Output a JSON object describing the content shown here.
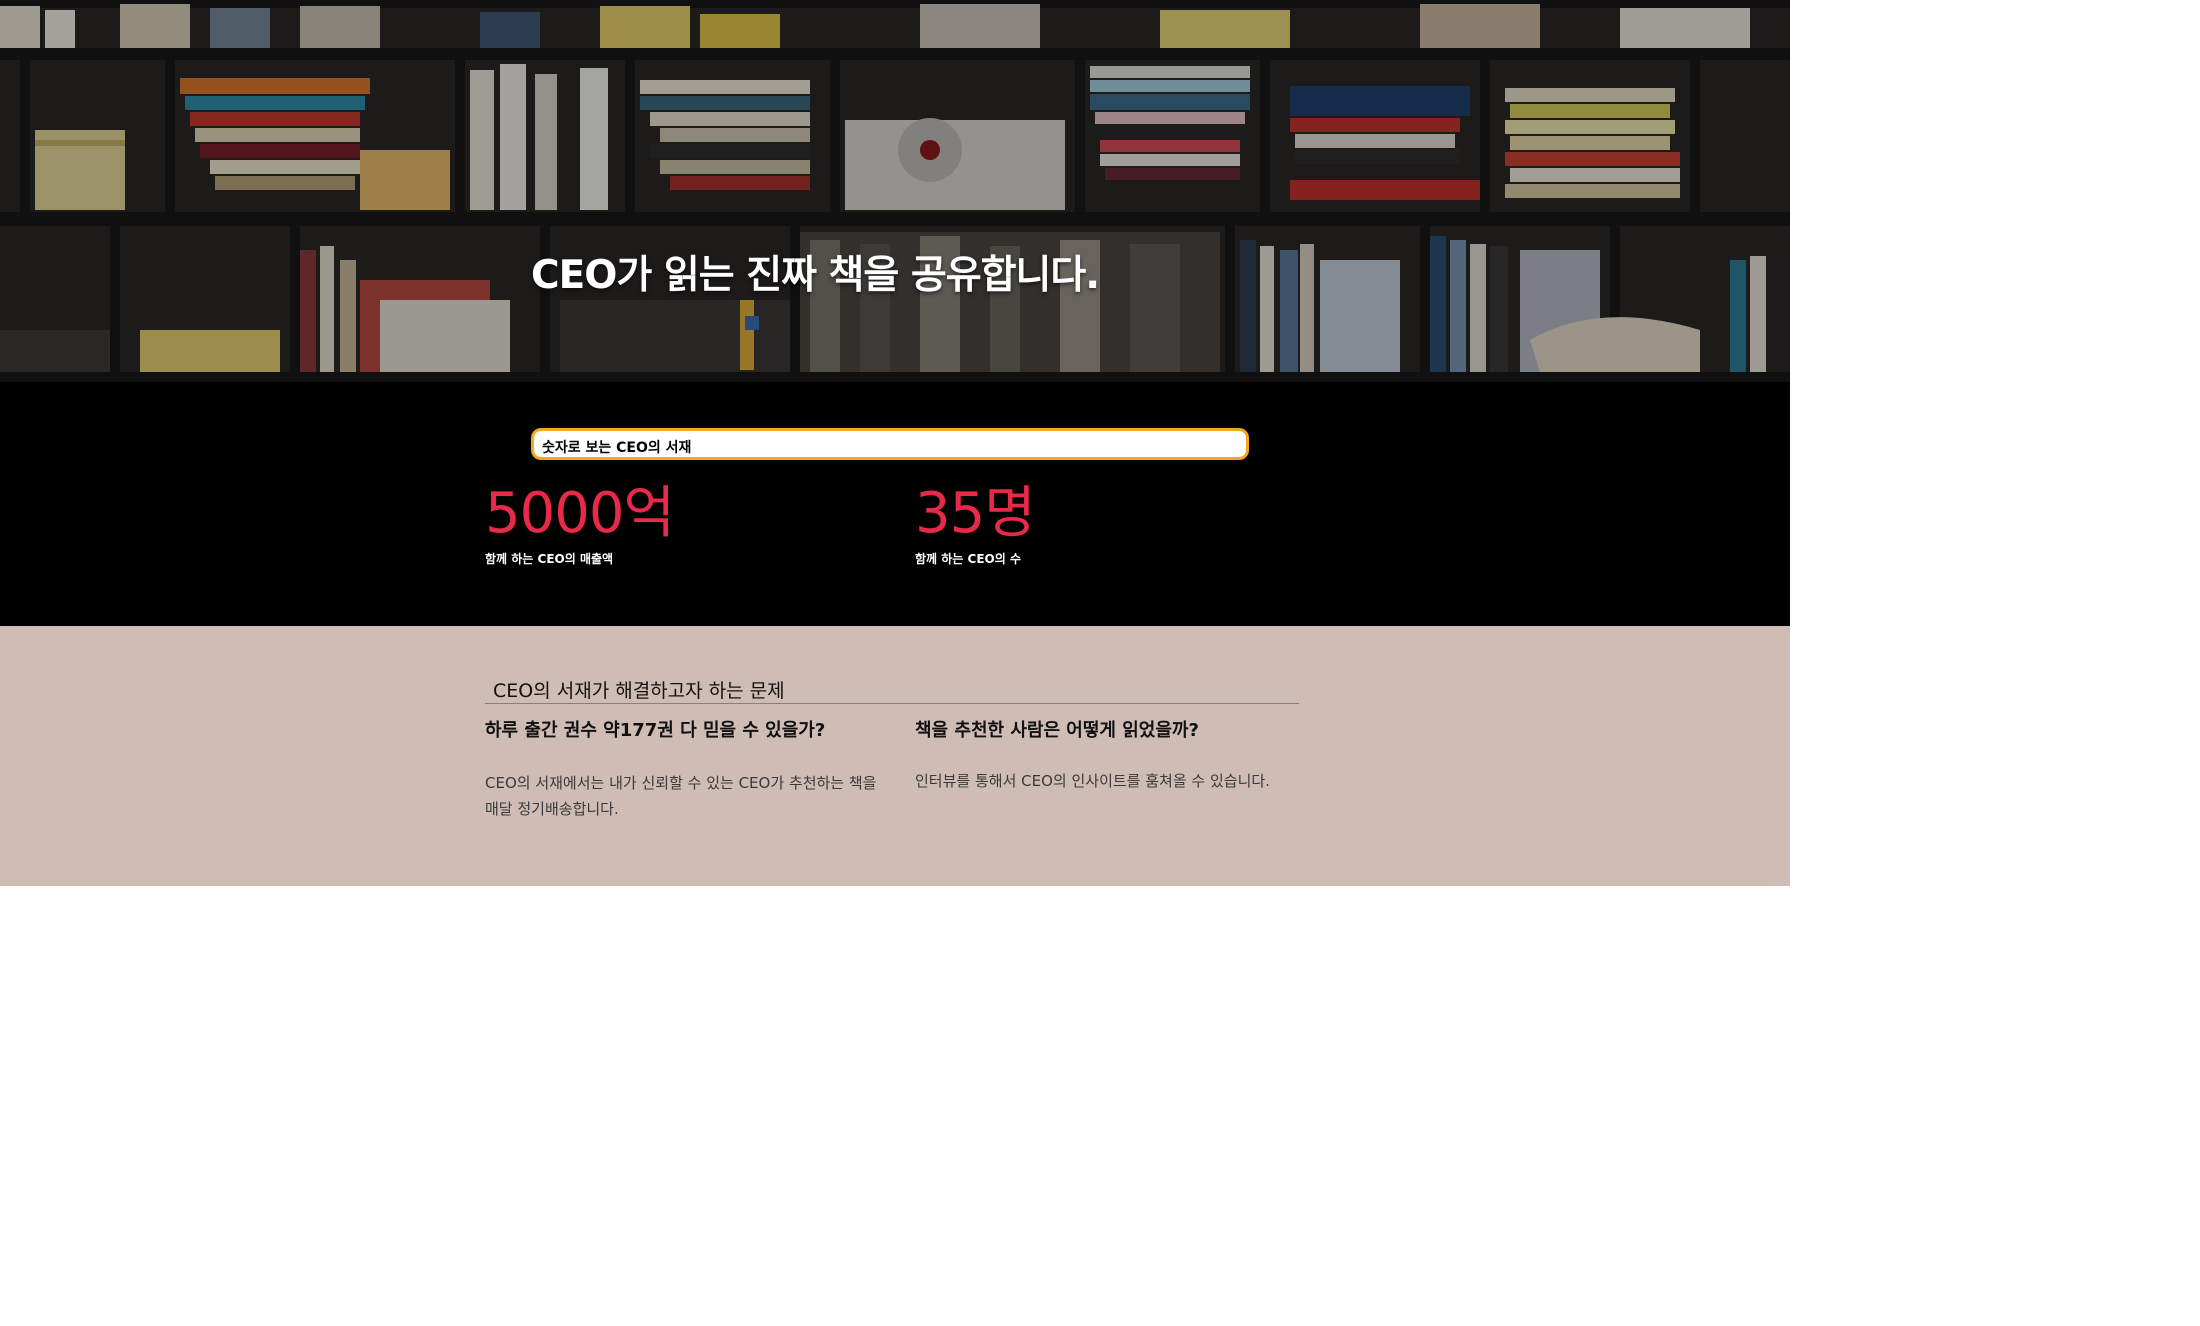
{
  "hero": {
    "title": "CEO가 읽는 진짜 책을 공유합니다.",
    "background_image": "bookshelf-photo"
  },
  "stats": {
    "banner_label": "숫자로 보는 CEO의 서재",
    "items": [
      {
        "value": "5000억",
        "label": "함께 하는 CEO의 매출액"
      },
      {
        "value": "35명",
        "label": "함께 하는 CEO의 수"
      }
    ],
    "colors": {
      "value": "#e8294a",
      "banner_border": "#f1a71f",
      "section_bg": "#000000"
    }
  },
  "problems": {
    "title": "CEO의 서재가 해결하고자 하는 문제",
    "items": [
      {
        "heading": "하루 출간 권수 약177권 다 믿을 수 있을가?",
        "text": "CEO의 서재에서는 내가 신뢰할 수 있는 CEO가 추천하는 책을 매달 정기배송합니다."
      },
      {
        "heading": "책을 추천한 사람은 어떻게 읽었을까?",
        "text": "인터뷰를 통해서 CEO의 인사이트를 훔쳐올 수 있습니다."
      }
    ],
    "colors": {
      "section_bg": "#cfbcb4"
    }
  }
}
